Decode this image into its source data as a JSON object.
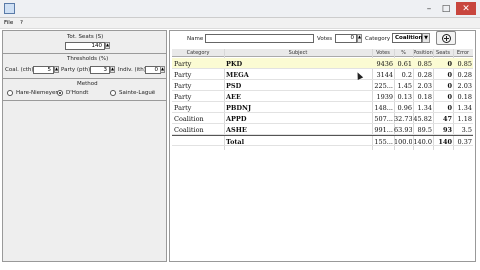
{
  "menu": {
    "file": "File",
    "help": "?"
  },
  "left": {
    "tot_seats_label": "Tot. Seats (S)",
    "tot_seats_value": "140",
    "thresholds_label": "Thresholds (%)",
    "coal_label": "Coal. (cth)",
    "coal_value": "5",
    "party_label": "Party (pth)",
    "party_value": "3",
    "indiv_label": "Indiv. (ith)",
    "indiv_value": "0",
    "method_label": "Method",
    "methods": [
      "Hare-Niemeyer",
      "D'Hondt",
      "Sainte-Laguë"
    ],
    "selected_method": "D'Hondt"
  },
  "toolbar": {
    "name_label": "Name",
    "name_value": "",
    "votes_label": "Votes",
    "votes_value": "0",
    "category_label": "Category",
    "category_value": "Coalition"
  },
  "table": {
    "headers": [
      "Category",
      "Subject",
      "Votes",
      "%",
      "Position",
      "Seats",
      "Error"
    ],
    "rows": [
      {
        "category": "Party",
        "subject": "PKD",
        "votes": "9436",
        "pct": "0.61",
        "position": "0.85",
        "seats": "0",
        "error": "0.85"
      },
      {
        "category": "Party",
        "subject": "MEGA",
        "votes": "3144",
        "pct": "0.2",
        "position": "0.28",
        "seats": "0",
        "error": "0.28"
      },
      {
        "category": "Party",
        "subject": "PSD",
        "votes": "225...",
        "pct": "1.45",
        "position": "2.03",
        "seats": "0",
        "error": "2.03"
      },
      {
        "category": "Party",
        "subject": "AEE",
        "votes": "1939",
        "pct": "0.13",
        "position": "0.18",
        "seats": "0",
        "error": "0.18"
      },
      {
        "category": "Party",
        "subject": "PBDNJ",
        "votes": "148...",
        "pct": "0.96",
        "position": "1.34",
        "seats": "0",
        "error": "1.34"
      },
      {
        "category": "Coalition",
        "subject": "APPD",
        "votes": "507...",
        "pct": "32.73",
        "position": "45.82",
        "seats": "47",
        "error": "1.18"
      },
      {
        "category": "Coalition",
        "subject": "ASHE",
        "votes": "991...",
        "pct": "63.93",
        "position": "89.5",
        "seats": "93",
        "error": "3.5"
      },
      {
        "category": "",
        "subject": "Total",
        "votes": "155...",
        "pct": "100.0",
        "position": "140.0",
        "seats": "140",
        "error": "0.37"
      }
    ]
  }
}
